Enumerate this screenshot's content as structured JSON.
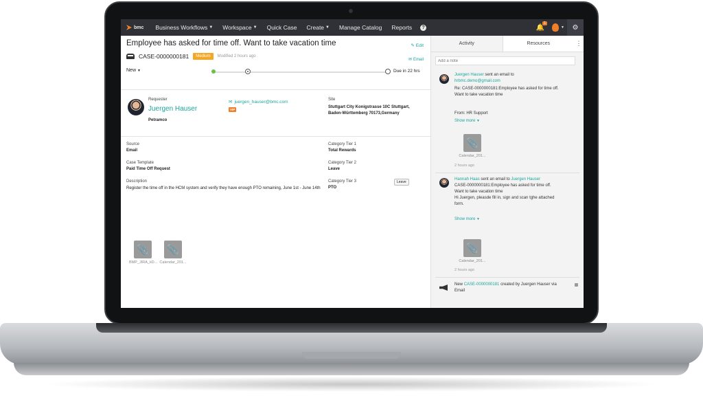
{
  "nav": {
    "logo": "bmc",
    "items": [
      "Business Workflows",
      "Workspace",
      "Quick Case",
      "Create",
      "Manage Catalog",
      "Reports"
    ],
    "help": "?",
    "notifications_count": "1"
  },
  "case": {
    "title": "Employee has asked for time off. Want to take vacation time",
    "edit_label": "Edit",
    "email_label": "Email",
    "id": "CASE-0000000181",
    "priority": "Medium",
    "modified": "Modified 2 hours ago",
    "status": "New",
    "due": "Due in 22 hrs"
  },
  "requester": {
    "label": "Requester",
    "name": "Juergen Hauser",
    "company": "Petramco",
    "email": "juergen_hauser@bmc.com",
    "vip": "VIP",
    "site_label": "Site",
    "site": "Stuttgart City Konigstrasse 10C Stuttgart, Baden-Württemberg 70173,Germany"
  },
  "details": {
    "source_label": "Source",
    "source": "Email",
    "template_label": "Case Template",
    "template": "Paid Time Off Request",
    "description_label": "Description",
    "description": "Register the time off in the HCM system and verify they have enough PTO remaining, June 1st - June 14th",
    "tier1_label": "Category Tier 1",
    "tier1": "Total Rewards",
    "tier2_label": "Category Tier 2",
    "tier2": "Leave",
    "tier3_label": "Category Tier 3",
    "tier3": "PTO",
    "leave_chip": "Leave"
  },
  "attachments": [
    "BMP_JIRA_kD...",
    "Calendar_201..."
  ],
  "panel": {
    "tabs": [
      "Activity",
      "Resources"
    ],
    "note_placeholder": "Add a note",
    "feed": [
      {
        "author": "Juergen Hauser",
        "action": "sent an email to",
        "target": "hrbmc.demo@gmail.com",
        "line1": "Re: CASE-0000000181:Employee has asked for time off.",
        "line2": "Want to take vacation time",
        "line3": "From: HR Support",
        "show_more": "Show more",
        "attachment": "Calendar_201...",
        "time": "2 hours ago"
      },
      {
        "author": "Hannah Haas",
        "action": "sent an email to",
        "target": "Juergen Hauser",
        "line1": "CASE-0000000181:Employee has asked for time off.",
        "line2": "Want to take vacation time",
        "line3": "Hi Juergen, pleasde fill in, sign and scan tghe attached",
        "line4": "form.",
        "show_more": "Show more",
        "attachment": "Calendar_201...",
        "time": "2 hours ago"
      },
      {
        "prefix": "New",
        "case_link": "CASE-0000000181",
        "text": "created by Juergen Hauser via",
        "text2": "Email"
      }
    ]
  }
}
